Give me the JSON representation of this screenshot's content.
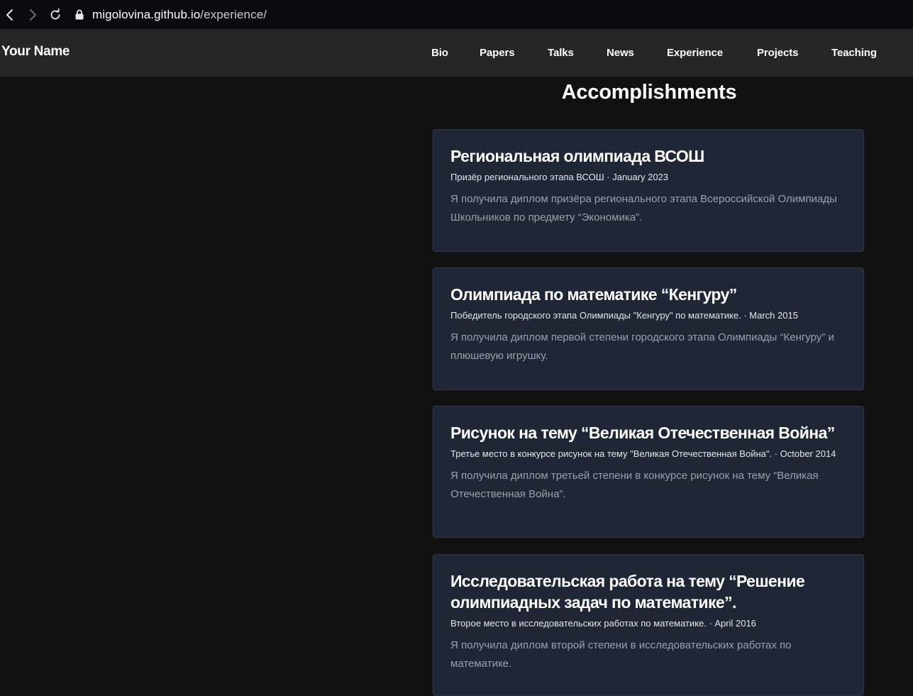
{
  "browser": {
    "url_domain": "migolovina.github.io",
    "url_path": "/experience/"
  },
  "header": {
    "brand": "Your Name",
    "nav": [
      {
        "label": "Bio"
      },
      {
        "label": "Papers"
      },
      {
        "label": "Talks"
      },
      {
        "label": "News"
      },
      {
        "label": "Experience"
      },
      {
        "label": "Projects"
      },
      {
        "label": "Teaching"
      }
    ]
  },
  "main": {
    "title": "Accomplishments",
    "cards": [
      {
        "title": "Региональная олимпиада ВСОШ",
        "subtitle": "Призёр регионального этапа ВСОШ · January 2023",
        "description": "Я получила диплом призёра регионального этапа Всероссийской Олимпиады Школьников по предмету “Экономика”."
      },
      {
        "title": "Олимпиада по математике “Кенгуру”",
        "subtitle": "Победитель городского этапа Олимпиады \"Кенгуру\" по математике. · March 2015",
        "description": "Я получила диплом первой степени городского этапа Олимпиады “Кенгуру” и плюшевую игрушку."
      },
      {
        "title": "Рисунок на тему “Великая Отечественная Война”",
        "subtitle": "Третье место в конкурсе рисунок на тему \"Великая Отечественная Война\". · October 2014",
        "description": "Я получила диплом третьей степени в конкурсе рисунок на тему “Великая Отечественная Война”."
      },
      {
        "title": "Исследовательская работа на тему “Решение олимпиадных задач по математике”.",
        "subtitle": "Второе место в исследовательских работах по математике. · April 2016",
        "description": "Я получила диплом второй степени в исследовательских работах по математике."
      }
    ]
  },
  "colors": {
    "page_bg": "#111111",
    "header_bg": "#262627",
    "card_bg": "#1f2636",
    "card_border": "#2f3748",
    "description_text": "#9aa0ab"
  }
}
